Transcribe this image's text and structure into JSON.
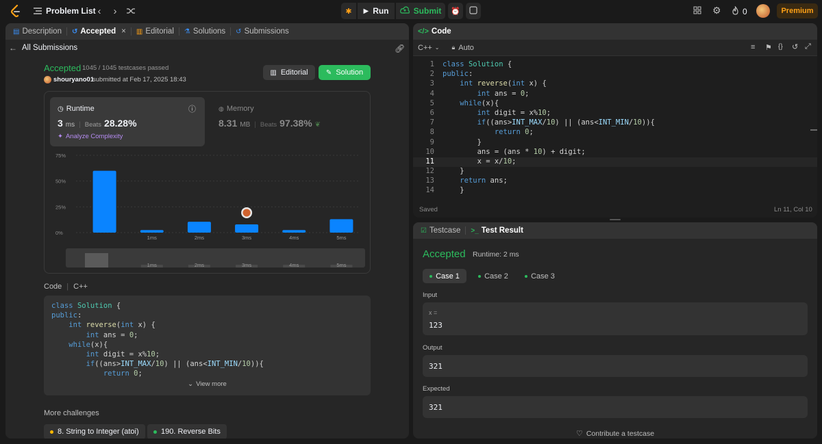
{
  "topbar": {
    "problem_list": "Problem List",
    "run": "Run",
    "submit": "Submit",
    "streak": "0",
    "premium": "Premium"
  },
  "left_tabs": [
    {
      "label": "Description",
      "icon": "doc-icon"
    },
    {
      "label": "Accepted",
      "icon": "history-icon"
    },
    {
      "label": "Editorial",
      "icon": "book-icon"
    },
    {
      "label": "Solutions",
      "icon": "flask-icon"
    },
    {
      "label": "Submissions",
      "icon": "history-icon"
    }
  ],
  "back_link": "All Submissions",
  "result": {
    "status": "Accepted",
    "passed": "1045 / 1045 testcases passed",
    "user": "shouryano01",
    "submitted": "submitted at Feb 17, 2025 18:43",
    "editorial_btn": "Editorial",
    "solution_btn": "Solution"
  },
  "runtime": {
    "label": "Runtime",
    "value": "3",
    "unit": "ms",
    "beats_label": "Beats",
    "beats": "28.28%",
    "analyze": "Analyze Complexity"
  },
  "memory": {
    "label": "Memory",
    "value": "8.31",
    "unit": "MB",
    "beats_label": "Beats",
    "beats": "97.38%"
  },
  "chart_data": {
    "type": "bar",
    "ytick_labels": [
      "75%",
      "50%",
      "25%",
      "0%"
    ],
    "yticks": [
      75,
      50,
      25,
      0
    ],
    "ylim": [
      0,
      75
    ],
    "bars": [
      {
        "x": 0,
        "value": 60,
        "label": ""
      },
      {
        "x": 1,
        "value": 2.5,
        "label": "1ms"
      },
      {
        "x": 2,
        "value": 10.5,
        "label": "2ms"
      },
      {
        "x": 3,
        "value": 8,
        "label": "3ms"
      },
      {
        "x": 4,
        "value": 2.5,
        "label": "4ms"
      },
      {
        "x": 5,
        "value": 13,
        "label": "5ms"
      }
    ],
    "highlight_x": 3,
    "overview_labels": [
      "1ms",
      "2ms",
      "3ms",
      "4ms",
      "5ms"
    ],
    "colors": {
      "bar": "#0a84ff",
      "grid": "#3a3a3a"
    }
  },
  "code_section": {
    "label": "Code",
    "lang": "C++",
    "view_more": "View more"
  },
  "code_preview": [
    "class Solution {",
    "public:",
    "    int reverse(int x) {",
    "        int ans = 0;",
    "    while(x){",
    "        int digit = x%10;",
    "        if((ans>INT_MAX/10) || (ans<INT_MIN/10)){",
    "            return 0;"
  ],
  "more_challenges": {
    "label": "More challenges",
    "items": [
      {
        "label": "8. String to Integer (atoi)",
        "color": "#ffb800"
      },
      {
        "label": "190. Reverse Bits",
        "color": "#2cbb5d"
      }
    ]
  },
  "editor": {
    "title": "Code",
    "lang": "C++",
    "mode": "Auto",
    "saved": "Saved",
    "cursor": "Ln 11, Col 10",
    "lines": [
      {
        "n": "1",
        "t": "class Solution {"
      },
      {
        "n": "2",
        "t": "public:"
      },
      {
        "n": "3",
        "t": "    int reverse(int x) {"
      },
      {
        "n": "4",
        "t": "        int ans = 0;"
      },
      {
        "n": "5",
        "t": "    while(x){"
      },
      {
        "n": "6",
        "t": "        int digit = x%10;"
      },
      {
        "n": "7",
        "t": "        if((ans>INT_MAX/10) || (ans<INT_MIN/10)){"
      },
      {
        "n": "8",
        "t": "            return 0;"
      },
      {
        "n": "9",
        "t": "        }"
      },
      {
        "n": "10",
        "t": "        ans = (ans * 10) + digit;"
      },
      {
        "n": "11",
        "t": "        x = x/10;"
      },
      {
        "n": "12",
        "t": "    }"
      },
      {
        "n": "13",
        "t": "    return ans;"
      },
      {
        "n": "14",
        "t": "    }"
      }
    ]
  },
  "testpanel": {
    "tab_testcase": "Testcase",
    "tab_result": "Test Result",
    "status": "Accepted",
    "runtime": "Runtime: 2 ms",
    "cases": [
      "Case 1",
      "Case 2",
      "Case 3"
    ],
    "input_label": "Input",
    "input_var": "x =",
    "input_val": "123",
    "output_label": "Output",
    "output_val": "321",
    "expected_label": "Expected",
    "expected_val": "321",
    "contribute": "Contribute a testcase"
  }
}
